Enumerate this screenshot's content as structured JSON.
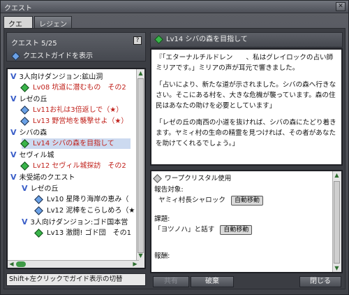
{
  "window": {
    "title": "クエスト",
    "close_label": "✕"
  },
  "tabs": [
    {
      "label": "クエスト",
      "active": true
    },
    {
      "label": "レジェンド",
      "active": false
    }
  ],
  "left": {
    "count_label": "クエスト 5/25",
    "help_label": "?",
    "guide_label": "クエストガイドを表示",
    "tree": [
      {
        "type": "group",
        "label": "3人向けダンジョン:鉱山洞"
      },
      {
        "type": "quest",
        "gem": "green",
        "label": "Lv08 坑道に潜むもの　その2",
        "red": true
      },
      {
        "type": "group",
        "label": "レゼの丘"
      },
      {
        "type": "quest",
        "gem": "blue",
        "label": "Lv11お礼は3倍返しで（★）",
        "red": true
      },
      {
        "type": "quest",
        "gem": "blue",
        "label": "Lv13 野営地を襲撃せよ（★）",
        "red": true
      },
      {
        "type": "group",
        "label": "シバの森"
      },
      {
        "type": "quest",
        "gem": "green",
        "label": "Lv14 シバの森を目指して",
        "red": true,
        "selected": true
      },
      {
        "type": "group",
        "label": "セヴィル城"
      },
      {
        "type": "quest",
        "gem": "green",
        "label": "Lv12 セヴィル城探訪　その2",
        "red": true
      },
      {
        "type": "group",
        "label": "未受諾のクエスト"
      },
      {
        "type": "subgroup",
        "label": "レゼの丘"
      },
      {
        "type": "subquest",
        "gem": "blue",
        "label": "Lv10 星降り海岸の恵み（"
      },
      {
        "type": "subquest",
        "gem": "blue",
        "label": "Lv12 泥棒をこらしめろ（★"
      },
      {
        "type": "subgroup",
        "label": "3人向けダンジョン:ゴド国本営"
      },
      {
        "type": "subquest",
        "gem": "green",
        "label": "Lv13 激闘! ゴド団　その1"
      }
    ],
    "hint": "Shift+左クリックでガイド表示の切替"
  },
  "right": {
    "quest_title": "Lv14 シバの森を目指して",
    "description": [
      "『「エターナルチルドレン　　、私はグレイロックの占い師 ミリアです。」ミリアの声が耳元で響きました。",
      "「占いにより、新たな道が示されました。シバの森へ行きなさい。そこにある村を、大きな危機が襲っています。森の住民はあなたの助けを必要としています」",
      "「レゼの丘の南西の小道を抜ければ、シバの森にたどり着きます。ヤミィ村の生命の精霊を見つければ、その者があなたを助けてくれるでしょう。」"
    ],
    "detail": {
      "header": "ワープクリスタル使用",
      "report_label": "報告対象:",
      "report_target": "ヤミィ村長シャロック",
      "auto_move_label": "自動移動",
      "task_label": "課題:",
      "task_text": "「ヨツノハ」と話す",
      "reward_label": "報酬:"
    },
    "buttons": {
      "share": "共有",
      "abandon": "破棄",
      "close": "閉じる"
    }
  }
}
